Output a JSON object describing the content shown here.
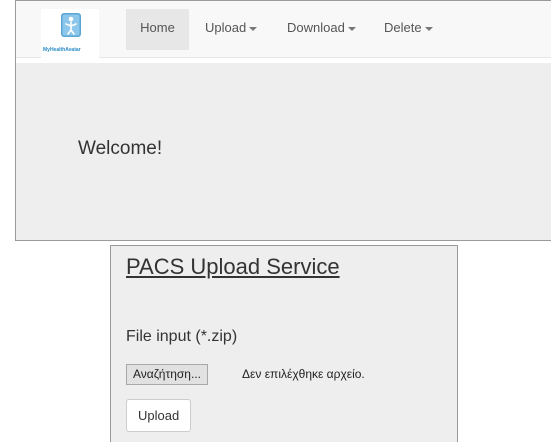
{
  "navbar": {
    "brand_text": "MyHealthAvatar",
    "items": [
      {
        "label": "Home",
        "active": true,
        "dropdown": false
      },
      {
        "label": "Upload",
        "active": false,
        "dropdown": true
      },
      {
        "label": "Download",
        "active": false,
        "dropdown": true
      },
      {
        "label": "Delete",
        "active": false,
        "dropdown": true
      }
    ]
  },
  "jumbotron": {
    "welcome_text": "Welcome!"
  },
  "upload": {
    "title": "PACS Upload Service",
    "file_label": "File input (*.zip)",
    "browse_label": "Αναζήτηση...",
    "no_file_text": "Δεν επιλέχθηκε αρχείο.",
    "upload_label": "Upload"
  },
  "colors": {
    "navbar_bg": "#f8f8f8",
    "active_tab_bg": "#e7e7e7",
    "jumbotron_bg": "#eeeeee",
    "brand_accent": "#2a8bc4"
  },
  "icons": {
    "brand_logo": "avatar-logo-icon",
    "dropdown": "caret-down-icon"
  }
}
